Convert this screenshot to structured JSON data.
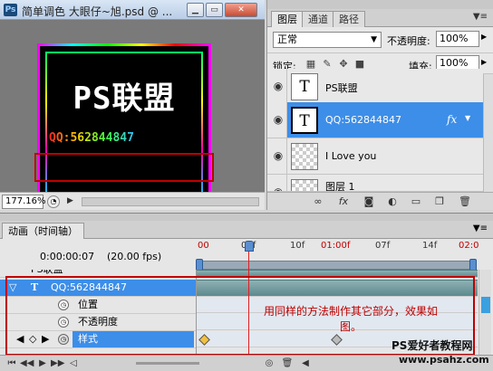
{
  "document": {
    "app_icon": "Ps",
    "title": "简单调色 大眼仔~旭.psd @ ...",
    "zoom": "177.16%",
    "artwork": {
      "title": "PS联盟",
      "subtitle": "QQ:562844847"
    }
  },
  "layers_panel": {
    "tabs": [
      "图层",
      "通道",
      "路径"
    ],
    "blend_mode": "正常",
    "opacity_label": "不透明度:",
    "opacity_value": "100%",
    "lock_label": "锁定:",
    "fill_label": "填充:",
    "fill_value": "100%",
    "layers": [
      {
        "name": "PS联盟",
        "thumb": "T",
        "selected": false
      },
      {
        "name": "QQ:562844847",
        "thumb": "T",
        "selected": true,
        "fx": "fx"
      },
      {
        "name": "I Love you",
        "thumb": "",
        "selected": false
      },
      {
        "name": "图层 1",
        "thumb": "",
        "selected": false
      }
    ]
  },
  "animation_panel": {
    "tab": "动画（时间轴）",
    "timecode": "0:00:00:07",
    "fps": "(20.00 fps)",
    "ruler": [
      "00",
      "05f",
      "10f",
      "14f",
      "01:00f",
      "07f",
      "14f",
      "02:0"
    ],
    "rows": {
      "partial_layer": "PS联盟",
      "selected_layer": "QQ:562844847",
      "prop_position": "位置",
      "prop_opacity": "不透明度",
      "prop_style": "样式"
    },
    "annotation": "用同样的方法制作其它部分，效果如图。"
  },
  "watermark": {
    "line1": "PS爱好者教程网",
    "line2": "www.psahz.com"
  },
  "colors": {
    "selection": "#3d8ee8",
    "annotation_red": "#c00000"
  }
}
